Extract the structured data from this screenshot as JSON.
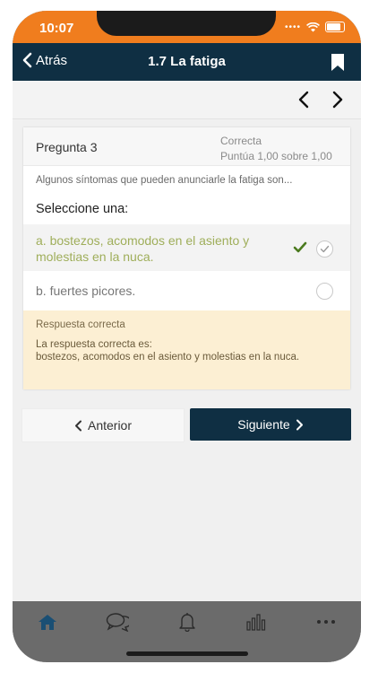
{
  "status_bar": {
    "time": "10:07"
  },
  "navbar": {
    "back_label": "Atrás",
    "title": "1.7 La fatiga"
  },
  "question": {
    "number_label": "Pregunta 3",
    "status": "Correcta",
    "score": "Puntúa 1,00 sobre 1,00",
    "text": "Algunos síntomas que pueden anunciarle la fatiga son...",
    "prompt": "Seleccione una:",
    "options": [
      {
        "label": "a. bostezos, acomodos en el asiento y molestias en la nuca.",
        "selected": true,
        "correct": true
      },
      {
        "label": "b. fuertes picores.",
        "selected": false,
        "correct": false
      }
    ]
  },
  "feedback": {
    "title": "Respuesta correcta",
    "text_intro": "La respuesta correcta es:",
    "text_answer": "bostezos, acomodos en el asiento y molestias en la nuca."
  },
  "buttons": {
    "prev_label": "Anterior",
    "next_label": "Siguiente"
  },
  "tabbar": {
    "items": [
      "home-icon",
      "chat-icon",
      "bell-icon",
      "chart-icon",
      "more-icon"
    ]
  },
  "colors": {
    "status_orange": "#f07d1e",
    "navy": "#0f2f43",
    "correct_green": "#9fae5a",
    "check_green": "#4b7a1e",
    "feedback_bg": "#fcefd3",
    "tabbar_gray": "#6b6b6b",
    "home_active": "#1a4f74"
  }
}
